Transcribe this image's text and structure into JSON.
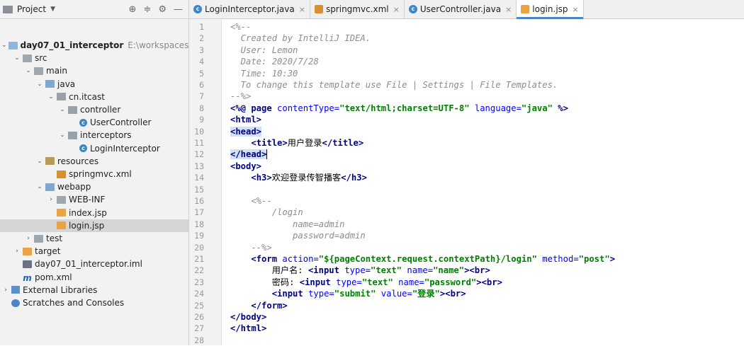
{
  "project_panel": {
    "title": "Project",
    "tree": [
      {
        "depth": 0,
        "arrow": "⌄",
        "icon": "module-folder",
        "label": "day07_01_interceptor",
        "path": "E:\\workspaces\\w-ide",
        "bold": true
      },
      {
        "depth": 1,
        "arrow": "⌄",
        "icon": "folder",
        "label": "src"
      },
      {
        "depth": 2,
        "arrow": "⌄",
        "icon": "folder",
        "label": "main"
      },
      {
        "depth": 3,
        "arrow": "⌄",
        "icon": "source-folder",
        "label": "java"
      },
      {
        "depth": 4,
        "arrow": "⌄",
        "icon": "package",
        "label": "cn.itcast"
      },
      {
        "depth": 5,
        "arrow": "⌄",
        "icon": "package",
        "label": "controller"
      },
      {
        "depth": 6,
        "arrow": "",
        "icon": "class",
        "label": "UserController"
      },
      {
        "depth": 5,
        "arrow": "⌄",
        "icon": "package",
        "label": "interceptors"
      },
      {
        "depth": 6,
        "arrow": "",
        "icon": "class",
        "label": "LoginInterceptor"
      },
      {
        "depth": 3,
        "arrow": "⌄",
        "icon": "resources-folder",
        "label": "resources"
      },
      {
        "depth": 4,
        "arrow": "",
        "icon": "xml-file",
        "label": "springmvc.xml"
      },
      {
        "depth": 3,
        "arrow": "⌄",
        "icon": "web-folder",
        "label": "webapp"
      },
      {
        "depth": 4,
        "arrow": "›",
        "icon": "folder",
        "label": "WEB-INF"
      },
      {
        "depth": 4,
        "arrow": "",
        "icon": "jsp-file",
        "label": "index.jsp"
      },
      {
        "depth": 4,
        "arrow": "",
        "icon": "jsp-file",
        "label": "login.jsp",
        "selected": true
      },
      {
        "depth": 2,
        "arrow": "›",
        "icon": "folder",
        "label": "test"
      },
      {
        "depth": 1,
        "arrow": "›",
        "icon": "target-folder",
        "label": "target"
      },
      {
        "depth": 1,
        "arrow": "",
        "icon": "iml-file",
        "label": "day07_01_interceptor.iml"
      },
      {
        "depth": 1,
        "arrow": "",
        "icon": "maven-icon",
        "label": "pom.xml"
      },
      {
        "depth": 0,
        "arrow": "›",
        "icon": "library",
        "label": "External Libraries"
      },
      {
        "depth": 0,
        "arrow": "",
        "icon": "scratches",
        "label": "Scratches and Consoles"
      }
    ]
  },
  "tabs": [
    {
      "label": "LoginInterceptor.java",
      "icon": "class",
      "active": false
    },
    {
      "label": "springmvc.xml",
      "icon": "xml",
      "active": false
    },
    {
      "label": "UserController.java",
      "icon": "class",
      "active": false
    },
    {
      "label": "login.jsp",
      "icon": "jsp",
      "active": true
    }
  ],
  "editor": {
    "line_numbers": [
      "1",
      "2",
      "3",
      "4",
      "5",
      "6",
      "7",
      "8",
      "9",
      "10",
      "11",
      "12",
      "13",
      "14",
      "15",
      "16",
      "17",
      "18",
      "19",
      "20",
      "21",
      "22",
      "23",
      "24",
      "25",
      "26",
      "27",
      "28"
    ],
    "lines": [
      [
        [
          "cm",
          "<%--"
        ]
      ],
      [
        [
          "cm",
          "  Created by IntelliJ IDEA."
        ]
      ],
      [
        [
          "cm",
          "  User: Lemon"
        ]
      ],
      [
        [
          "cm",
          "  Date: 2020/7/28"
        ]
      ],
      [
        [
          "cm",
          "  Time: 10:30"
        ]
      ],
      [
        [
          "cm",
          "  To change this template use File | Settings | File Templates."
        ]
      ],
      [
        [
          "cm",
          "--%>"
        ]
      ],
      [
        [
          "tg",
          "<%@ page "
        ],
        [
          "at",
          "contentType="
        ],
        [
          "st",
          "\"text/html;charset=UTF-8\""
        ],
        [
          "at",
          " language="
        ],
        [
          "st",
          "\"java\""
        ],
        [
          "tg",
          " %>"
        ]
      ],
      [
        [
          "tg",
          "<html>"
        ]
      ],
      [
        [
          "tg hl",
          "<head>"
        ]
      ],
      [
        [
          "",
          "    "
        ],
        [
          "tg",
          "<title>"
        ],
        [
          "",
          "用户登录"
        ],
        [
          "tg",
          "</title>"
        ]
      ],
      [
        [
          "tg hl",
          "</head>"
        ],
        [
          "cur",
          ""
        ]
      ],
      [
        [
          "tg",
          "<body>"
        ]
      ],
      [
        [
          "",
          "    "
        ],
        [
          "tg",
          "<h3>"
        ],
        [
          "",
          "欢迎登录传智播客"
        ],
        [
          "tg",
          "</h3>"
        ]
      ],
      [
        [
          "",
          ""
        ]
      ],
      [
        [
          "cm",
          "    <%--"
        ]
      ],
      [
        [
          "cm",
          "        /login"
        ]
      ],
      [
        [
          "cm",
          "            name=admin"
        ]
      ],
      [
        [
          "cm",
          "            password=admin"
        ]
      ],
      [
        [
          "cm",
          "    --%>"
        ]
      ],
      [
        [
          "",
          "    "
        ],
        [
          "tg",
          "<form "
        ],
        [
          "at",
          "action="
        ],
        [
          "st",
          "\"${pageContext.request.contextPath}/login\""
        ],
        [
          "at",
          " method="
        ],
        [
          "st",
          "\"post\""
        ],
        [
          "tg",
          ">"
        ]
      ],
      [
        [
          "",
          "        用户名: "
        ],
        [
          "tg",
          "<input "
        ],
        [
          "at",
          "type="
        ],
        [
          "st",
          "\"text\""
        ],
        [
          "at",
          " name="
        ],
        [
          "st",
          "\"name\""
        ],
        [
          "tg",
          "><br>"
        ]
      ],
      [
        [
          "",
          "        密码: "
        ],
        [
          "tg",
          "<input "
        ],
        [
          "at",
          "type="
        ],
        [
          "st",
          "\"text\""
        ],
        [
          "at",
          " name="
        ],
        [
          "st",
          "\"password\""
        ],
        [
          "tg",
          "><br>"
        ]
      ],
      [
        [
          "",
          "        "
        ],
        [
          "tg",
          "<input "
        ],
        [
          "at",
          "type="
        ],
        [
          "st",
          "\"submit\""
        ],
        [
          "at",
          " value="
        ],
        [
          "st",
          "\"登录\""
        ],
        [
          "tg",
          "><br>"
        ]
      ],
      [
        [
          "",
          "    "
        ],
        [
          "tg",
          "</form>"
        ]
      ],
      [
        [
          "tg",
          "</body>"
        ]
      ],
      [
        [
          "tg",
          "</html>"
        ]
      ],
      [
        [
          "",
          ""
        ]
      ]
    ]
  }
}
